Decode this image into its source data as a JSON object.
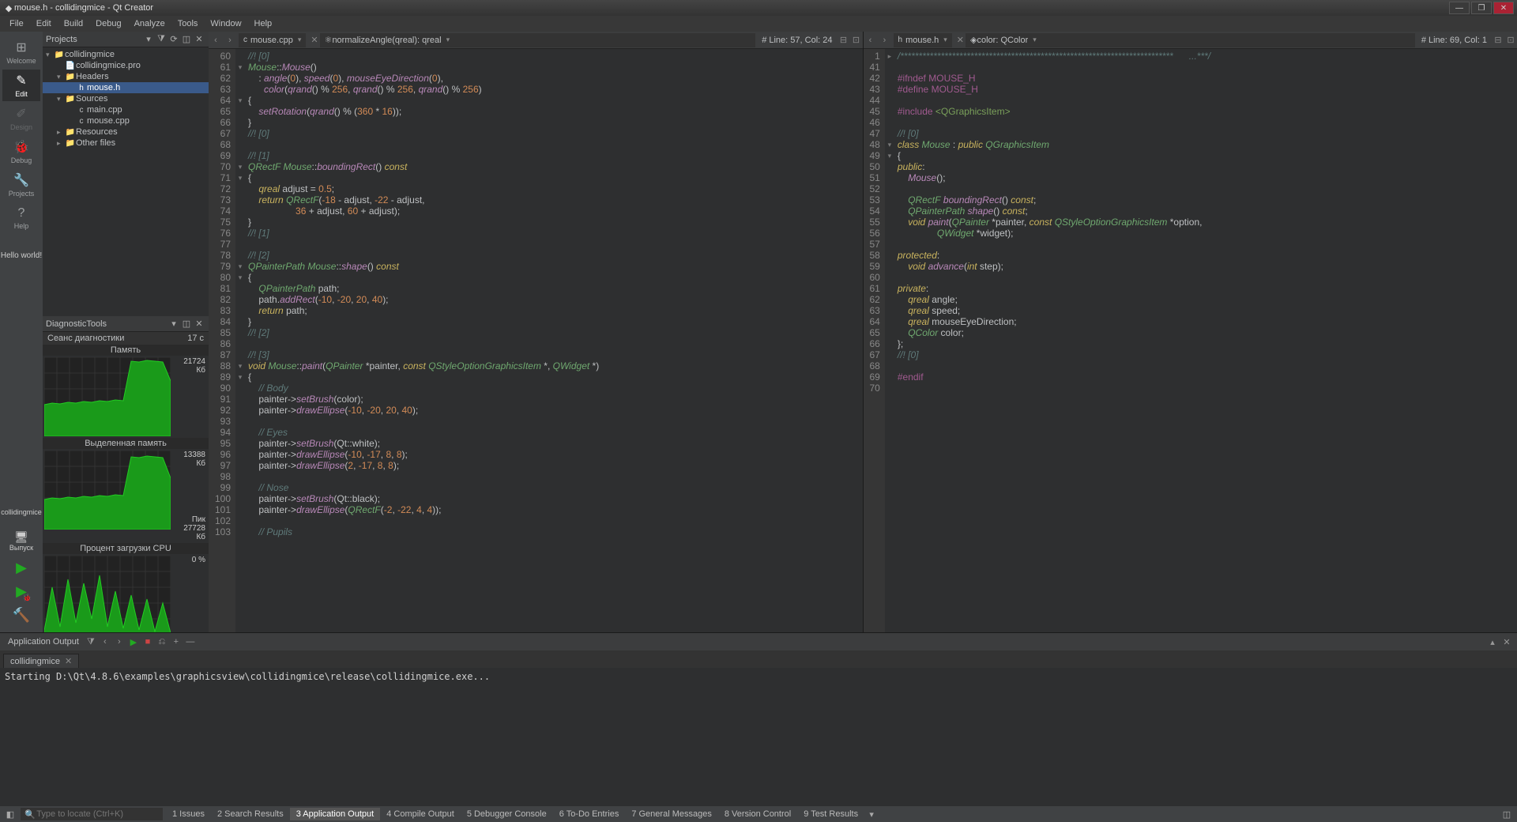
{
  "window": {
    "title": "mouse.h - collidingmice - Qt Creator"
  },
  "menu": [
    "File",
    "Edit",
    "Build",
    "Debug",
    "Analyze",
    "Tools",
    "Window",
    "Help"
  ],
  "modes": [
    {
      "label": "Welcome",
      "icon": "⊞"
    },
    {
      "label": "Edit",
      "icon": "✎",
      "active": true
    },
    {
      "label": "Design",
      "icon": "✐",
      "disabled": true
    },
    {
      "label": "Debug",
      "icon": "🐞"
    },
    {
      "label": "Projects",
      "icon": "🔧"
    },
    {
      "label": "Help",
      "icon": "?"
    }
  ],
  "hello": "Hello world!",
  "kit": {
    "project": "collidingmice",
    "build": "Выпуск",
    "icon": "🖥"
  },
  "projectsPane": {
    "title": "Projects"
  },
  "tree": [
    {
      "d": 0,
      "arrow": "▾",
      "icon": "📁",
      "label": "collidingmice"
    },
    {
      "d": 1,
      "arrow": " ",
      "icon": "📄",
      "label": "collidingmice.pro"
    },
    {
      "d": 1,
      "arrow": "▾",
      "icon": "📁",
      "label": "Headers"
    },
    {
      "d": 2,
      "arrow": " ",
      "icon": "h",
      "label": "mouse.h",
      "selected": true
    },
    {
      "d": 1,
      "arrow": "▾",
      "icon": "📁",
      "label": "Sources"
    },
    {
      "d": 2,
      "arrow": " ",
      "icon": "c",
      "label": "main.cpp"
    },
    {
      "d": 2,
      "arrow": " ",
      "icon": "c",
      "label": "mouse.cpp"
    },
    {
      "d": 1,
      "arrow": "▸",
      "icon": "📁",
      "label": "Resources"
    },
    {
      "d": 1,
      "arrow": "▸",
      "icon": "📁",
      "label": "Other files"
    }
  ],
  "diag": {
    "title": "DiagnosticTools",
    "session_label": "Сеанс диагностики",
    "session_time": "17 с",
    "mem_label": "Память",
    "mem_val": "21724 Кб",
    "alloc_label": "Выделенная память",
    "alloc_val": "13388 Кб",
    "alloc_peak": "Пик",
    "alloc_peak_val": "27728 Кб",
    "cpu_label": "Процент загрузки CPU",
    "cpu_val": "0 %"
  },
  "chart_data": [
    {
      "type": "area",
      "name": "memory",
      "values": [
        40,
        42,
        41,
        43,
        42,
        44,
        43,
        45,
        44,
        46,
        45,
        95,
        94,
        96,
        95,
        94,
        70
      ],
      "ylim": [
        0,
        100
      ]
    },
    {
      "type": "area",
      "name": "allocated",
      "values": [
        38,
        40,
        39,
        41,
        40,
        42,
        41,
        43,
        42,
        44,
        43,
        92,
        91,
        93,
        92,
        91,
        65
      ],
      "ylim": [
        0,
        100
      ]
    },
    {
      "type": "area",
      "name": "cpu",
      "values": [
        5,
        60,
        10,
        70,
        15,
        65,
        20,
        75,
        10,
        55,
        8,
        50,
        6,
        45,
        4,
        40,
        2
      ],
      "ylim": [
        0,
        100
      ]
    }
  ],
  "editorLeft": {
    "file": "mouse.cpp",
    "symbol": "normalizeAngle(qreal): qreal",
    "symbolIcon": "⚛",
    "pos": "Line: 57, Col: 24",
    "startLine": 60,
    "lines": [
      [
        [
          "cmt",
          "//! [0]"
        ]
      ],
      [
        [
          "type",
          "Mouse"
        ],
        [
          "op",
          "::"
        ],
        [
          "func",
          "Mouse"
        ],
        [
          "op",
          "()"
        ]
      ],
      [
        [
          "op",
          "    : "
        ],
        [
          "func",
          "angle"
        ],
        [
          "op",
          "("
        ],
        [
          "num",
          "0"
        ],
        [
          "op",
          "), "
        ],
        [
          "func",
          "speed"
        ],
        [
          "op",
          "("
        ],
        [
          "num",
          "0"
        ],
        [
          "op",
          "), "
        ],
        [
          "func",
          "mouseEyeDirection"
        ],
        [
          "op",
          "("
        ],
        [
          "num",
          "0"
        ],
        [
          "op",
          "),"
        ]
      ],
      [
        [
          "op",
          "      "
        ],
        [
          "func",
          "color"
        ],
        [
          "op",
          "("
        ],
        [
          "func",
          "qrand"
        ],
        [
          "op",
          "() % "
        ],
        [
          "num",
          "256"
        ],
        [
          "op",
          ", "
        ],
        [
          "func",
          "qrand"
        ],
        [
          "op",
          "() % "
        ],
        [
          "num",
          "256"
        ],
        [
          "op",
          ", "
        ],
        [
          "func",
          "qrand"
        ],
        [
          "op",
          "() % "
        ],
        [
          "num",
          "256"
        ],
        [
          "op",
          ")"
        ]
      ],
      [
        [
          "op",
          "{"
        ]
      ],
      [
        [
          "op",
          "    "
        ],
        [
          "func",
          "setRotation"
        ],
        [
          "op",
          "("
        ],
        [
          "func",
          "qrand"
        ],
        [
          "op",
          "() % ("
        ],
        [
          "num",
          "360"
        ],
        [
          "op",
          " * "
        ],
        [
          "num",
          "16"
        ],
        [
          "op",
          "));"
        ]
      ],
      [
        [
          "op",
          "}"
        ]
      ],
      [
        [
          "cmt",
          "//! [0]"
        ]
      ],
      [],
      [
        [
          "cmt",
          "//! [1]"
        ]
      ],
      [
        [
          "type",
          "QRectF "
        ],
        [
          "type",
          "Mouse"
        ],
        [
          "op",
          "::"
        ],
        [
          "func",
          "boundingRect"
        ],
        [
          "op",
          "() "
        ],
        [
          "kw",
          "const"
        ]
      ],
      [
        [
          "op",
          "{"
        ]
      ],
      [
        [
          "op",
          "    "
        ],
        [
          "kw",
          "qreal"
        ],
        [
          "op",
          " adjust = "
        ],
        [
          "num",
          "0.5"
        ],
        [
          "op",
          ";"
        ]
      ],
      [
        [
          "op",
          "    "
        ],
        [
          "kw",
          "return"
        ],
        [
          "op",
          " "
        ],
        [
          "type",
          "QRectF"
        ],
        [
          "op",
          "("
        ],
        [
          "num",
          "-18"
        ],
        [
          "op",
          " - adjust, "
        ],
        [
          "num",
          "-22"
        ],
        [
          "op",
          " - adjust,"
        ]
      ],
      [
        [
          "op",
          "                  "
        ],
        [
          "num",
          "36"
        ],
        [
          "op",
          " + adjust, "
        ],
        [
          "num",
          "60"
        ],
        [
          "op",
          " + adjust);"
        ]
      ],
      [
        [
          "op",
          "}"
        ]
      ],
      [
        [
          "cmt",
          "//! [1]"
        ]
      ],
      [],
      [
        [
          "cmt",
          "//! [2]"
        ]
      ],
      [
        [
          "type",
          "QPainterPath "
        ],
        [
          "type",
          "Mouse"
        ],
        [
          "op",
          "::"
        ],
        [
          "func",
          "shape"
        ],
        [
          "op",
          "() "
        ],
        [
          "kw",
          "const"
        ]
      ],
      [
        [
          "op",
          "{"
        ]
      ],
      [
        [
          "op",
          "    "
        ],
        [
          "type",
          "QPainterPath"
        ],
        [
          "op",
          " path;"
        ]
      ],
      [
        [
          "op",
          "    path."
        ],
        [
          "func",
          "addRect"
        ],
        [
          "op",
          "("
        ],
        [
          "num",
          "-10"
        ],
        [
          "op",
          ", "
        ],
        [
          "num",
          "-20"
        ],
        [
          "op",
          ", "
        ],
        [
          "num",
          "20"
        ],
        [
          "op",
          ", "
        ],
        [
          "num",
          "40"
        ],
        [
          "op",
          ");"
        ]
      ],
      [
        [
          "op",
          "    "
        ],
        [
          "kw",
          "return"
        ],
        [
          "op",
          " path;"
        ]
      ],
      [
        [
          "op",
          "}"
        ]
      ],
      [
        [
          "cmt",
          "//! [2]"
        ]
      ],
      [],
      [
        [
          "cmt",
          "//! [3]"
        ]
      ],
      [
        [
          "kw",
          "void"
        ],
        [
          "op",
          " "
        ],
        [
          "type",
          "Mouse"
        ],
        [
          "op",
          "::"
        ],
        [
          "func",
          "paint"
        ],
        [
          "op",
          "("
        ],
        [
          "type",
          "QPainter"
        ],
        [
          "op",
          " *painter, "
        ],
        [
          "kw",
          "const"
        ],
        [
          "op",
          " "
        ],
        [
          "type",
          "QStyleOptionGraphicsItem"
        ],
        [
          "op",
          " *, "
        ],
        [
          "type",
          "QWidget"
        ],
        [
          "op",
          " *)"
        ]
      ],
      [
        [
          "op",
          "{"
        ]
      ],
      [
        [
          "op",
          "    "
        ],
        [
          "cmt",
          "// Body"
        ]
      ],
      [
        [
          "op",
          "    painter->"
        ],
        [
          "func",
          "setBrush"
        ],
        [
          "op",
          "(color);"
        ]
      ],
      [
        [
          "op",
          "    painter->"
        ],
        [
          "func",
          "drawEllipse"
        ],
        [
          "op",
          "("
        ],
        [
          "num",
          "-10"
        ],
        [
          "op",
          ", "
        ],
        [
          "num",
          "-20"
        ],
        [
          "op",
          ", "
        ],
        [
          "num",
          "20"
        ],
        [
          "op",
          ", "
        ],
        [
          "num",
          "40"
        ],
        [
          "op",
          ");"
        ]
      ],
      [],
      [
        [
          "op",
          "    "
        ],
        [
          "cmt",
          "// Eyes"
        ]
      ],
      [
        [
          "op",
          "    painter->"
        ],
        [
          "func",
          "setBrush"
        ],
        [
          "op",
          "(Qt::white);"
        ]
      ],
      [
        [
          "op",
          "    painter->"
        ],
        [
          "func",
          "drawEllipse"
        ],
        [
          "op",
          "("
        ],
        [
          "num",
          "-10"
        ],
        [
          "op",
          ", "
        ],
        [
          "num",
          "-17"
        ],
        [
          "op",
          ", "
        ],
        [
          "num",
          "8"
        ],
        [
          "op",
          ", "
        ],
        [
          "num",
          "8"
        ],
        [
          "op",
          ");"
        ]
      ],
      [
        [
          "op",
          "    painter->"
        ],
        [
          "func",
          "drawEllipse"
        ],
        [
          "op",
          "("
        ],
        [
          "num",
          "2"
        ],
        [
          "op",
          ", "
        ],
        [
          "num",
          "-17"
        ],
        [
          "op",
          ", "
        ],
        [
          "num",
          "8"
        ],
        [
          "op",
          ", "
        ],
        [
          "num",
          "8"
        ],
        [
          "op",
          ");"
        ]
      ],
      [],
      [
        [
          "op",
          "    "
        ],
        [
          "cmt",
          "// Nose"
        ]
      ],
      [
        [
          "op",
          "    painter->"
        ],
        [
          "func",
          "setBrush"
        ],
        [
          "op",
          "(Qt::black);"
        ]
      ],
      [
        [
          "op",
          "    painter->"
        ],
        [
          "func",
          "drawEllipse"
        ],
        [
          "op",
          "("
        ],
        [
          "type",
          "QRectF"
        ],
        [
          "op",
          "("
        ],
        [
          "num",
          "-2"
        ],
        [
          "op",
          ", "
        ],
        [
          "num",
          "-22"
        ],
        [
          "op",
          ", "
        ],
        [
          "num",
          "4"
        ],
        [
          "op",
          ", "
        ],
        [
          "num",
          "4"
        ],
        [
          "op",
          "));"
        ]
      ],
      [],
      [
        [
          "op",
          "    "
        ],
        [
          "cmt",
          "// Pupils"
        ]
      ]
    ],
    "folds": {
      "1": "▾",
      "4": "▾",
      "10": "▾",
      "11": "▾",
      "19": "▾",
      "20": "▾",
      "28": "▾",
      "29": "▾"
    }
  },
  "editorRight": {
    "file": "mouse.h",
    "symbol": "color: QColor",
    "symbolIcon": "◈",
    "pos": "Line: 69, Col: 1",
    "startLine": 1,
    "bannerLine": 40,
    "lines": [
      [
        [
          "cmt",
          "/**************************************************************************      ...***/"
        ]
      ],
      [],
      [
        [
          "pre",
          "#ifndef"
        ],
        [
          "op",
          " "
        ],
        [
          "pre",
          "MOUSE_H"
        ]
      ],
      [
        [
          "pre",
          "#define"
        ],
        [
          "op",
          " "
        ],
        [
          "pre",
          "MOUSE_H"
        ]
      ],
      [],
      [
        [
          "pre",
          "#include"
        ],
        [
          "op",
          " "
        ],
        [
          "str",
          "<QGraphicsItem>"
        ]
      ],
      [],
      [
        [
          "cmt",
          "//! [0]"
        ]
      ],
      [
        [
          "kw",
          "class"
        ],
        [
          "op",
          " "
        ],
        [
          "type",
          "Mouse"
        ],
        [
          "op",
          " : "
        ],
        [
          "kw",
          "public"
        ],
        [
          "op",
          " "
        ],
        [
          "type",
          "QGraphicsItem"
        ]
      ],
      [
        [
          "op",
          "{"
        ]
      ],
      [
        [
          "kw",
          "public"
        ],
        [
          "op",
          ":"
        ]
      ],
      [
        [
          "op",
          "    "
        ],
        [
          "func",
          "Mouse"
        ],
        [
          "op",
          "();"
        ]
      ],
      [],
      [
        [
          "op",
          "    "
        ],
        [
          "type",
          "QRectF"
        ],
        [
          "op",
          " "
        ],
        [
          "func",
          "boundingRect"
        ],
        [
          "op",
          "() "
        ],
        [
          "kw",
          "const"
        ],
        [
          "op",
          ";"
        ]
      ],
      [
        [
          "op",
          "    "
        ],
        [
          "type",
          "QPainterPath"
        ],
        [
          "op",
          " "
        ],
        [
          "func",
          "shape"
        ],
        [
          "op",
          "() "
        ],
        [
          "kw",
          "const"
        ],
        [
          "op",
          ";"
        ]
      ],
      [
        [
          "op",
          "    "
        ],
        [
          "kw",
          "void"
        ],
        [
          "op",
          " "
        ],
        [
          "func",
          "paint"
        ],
        [
          "op",
          "("
        ],
        [
          "type",
          "QPainter"
        ],
        [
          "op",
          " *painter, "
        ],
        [
          "kw",
          "const"
        ],
        [
          "op",
          " "
        ],
        [
          "type",
          "QStyleOptionGraphicsItem"
        ],
        [
          "op",
          " *option,"
        ]
      ],
      [
        [
          "op",
          "               "
        ],
        [
          "type",
          "QWidget"
        ],
        [
          "op",
          " *widget);"
        ]
      ],
      [],
      [
        [
          "kw",
          "protected"
        ],
        [
          "op",
          ":"
        ]
      ],
      [
        [
          "op",
          "    "
        ],
        [
          "kw",
          "void"
        ],
        [
          "op",
          " "
        ],
        [
          "func",
          "advance"
        ],
        [
          "op",
          "("
        ],
        [
          "kw",
          "int"
        ],
        [
          "op",
          " step);"
        ]
      ],
      [],
      [
        [
          "kw",
          "private"
        ],
        [
          "op",
          ":"
        ]
      ],
      [
        [
          "op",
          "    "
        ],
        [
          "kw",
          "qreal"
        ],
        [
          "op",
          " angle;"
        ]
      ],
      [
        [
          "op",
          "    "
        ],
        [
          "kw",
          "qreal"
        ],
        [
          "op",
          " speed;"
        ]
      ],
      [
        [
          "op",
          "    "
        ],
        [
          "kw",
          "qreal"
        ],
        [
          "op",
          " mouseEyeDirection;"
        ]
      ],
      [
        [
          "op",
          "    "
        ],
        [
          "type",
          "QColor"
        ],
        [
          "op",
          " color;"
        ]
      ],
      [
        [
          "op",
          "};"
        ]
      ],
      [
        [
          "cmt",
          "//! [0]"
        ]
      ],
      [],
      [
        [
          "pre",
          "#endif"
        ]
      ],
      [
        [
          "op",
          " "
        ]
      ]
    ],
    "folds": {
      "0": "▸",
      "8": "▾",
      "9": "▾"
    }
  },
  "appOutput": {
    "title": "Application Output",
    "tab": "collidingmice",
    "text": "Starting D:\\Qt\\4.8.6\\examples\\graphicsview\\collidingmice\\release\\collidingmice.exe..."
  },
  "status": {
    "locate_placeholder": "Type to locate (Ctrl+K)",
    "panes": [
      "1  Issues",
      "2  Search Results",
      "3  Application Output",
      "4  Compile Output",
      "5  Debugger Console",
      "6  To-Do Entries",
      "7  General Messages",
      "8  Version Control",
      "9  Test Results"
    ],
    "active": 2
  }
}
